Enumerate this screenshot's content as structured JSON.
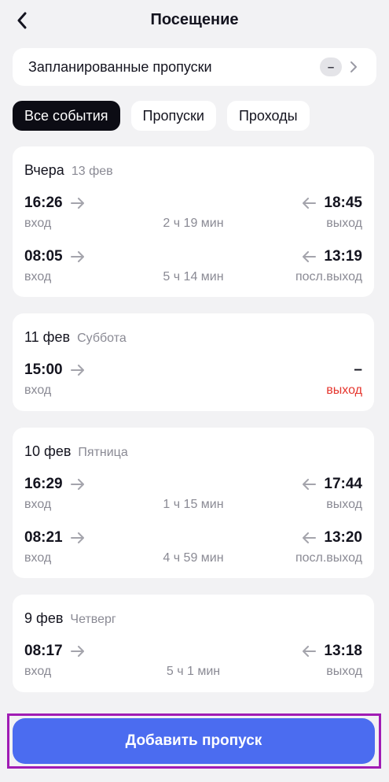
{
  "header": {
    "title": "Посещение"
  },
  "planned": {
    "label": "Запланированные пропуски",
    "badge": "–"
  },
  "tabs": [
    {
      "label": "Все события",
      "active": true
    },
    {
      "label": "Пропуски",
      "active": false
    },
    {
      "label": "Проходы",
      "active": false
    }
  ],
  "days": [
    {
      "date": "Вчера",
      "sub": "13 фев",
      "entries": [
        {
          "in_time": "16:26",
          "in_label": "вход",
          "duration": "2 ч 19 мин",
          "out_time": "18:45",
          "out_label": "выход"
        },
        {
          "in_time": "08:05",
          "in_label": "вход",
          "duration": "5 ч 14 мин",
          "out_time": "13:19",
          "out_label": "посл.выход"
        }
      ]
    },
    {
      "date": "11 фев",
      "sub": "Суббота",
      "entries": [
        {
          "in_time": "15:00",
          "in_label": "вход",
          "duration": "",
          "out_time": "–",
          "out_label": "выход"
        }
      ]
    },
    {
      "date": "10 фев",
      "sub": "Пятница",
      "entries": [
        {
          "in_time": "16:29",
          "in_label": "вход",
          "duration": "1 ч 15 мин",
          "out_time": "17:44",
          "out_label": "выход"
        },
        {
          "in_time": "08:21",
          "in_label": "вход",
          "duration": "4 ч 59 мин",
          "out_time": "13:20",
          "out_label": "посл.выход"
        }
      ]
    },
    {
      "date": "9 фев",
      "sub": "Четверг",
      "entries": [
        {
          "in_time": "08:17",
          "in_label": "вход",
          "duration": "5 ч 1 мин",
          "out_time": "13:18",
          "out_label": "выход"
        }
      ]
    }
  ],
  "footer": {
    "add_button": "Добавить пропуск"
  },
  "colors": {
    "accent": "#4b6cf0",
    "alert": "#e5342c",
    "active_tab": "#0c0c14"
  }
}
